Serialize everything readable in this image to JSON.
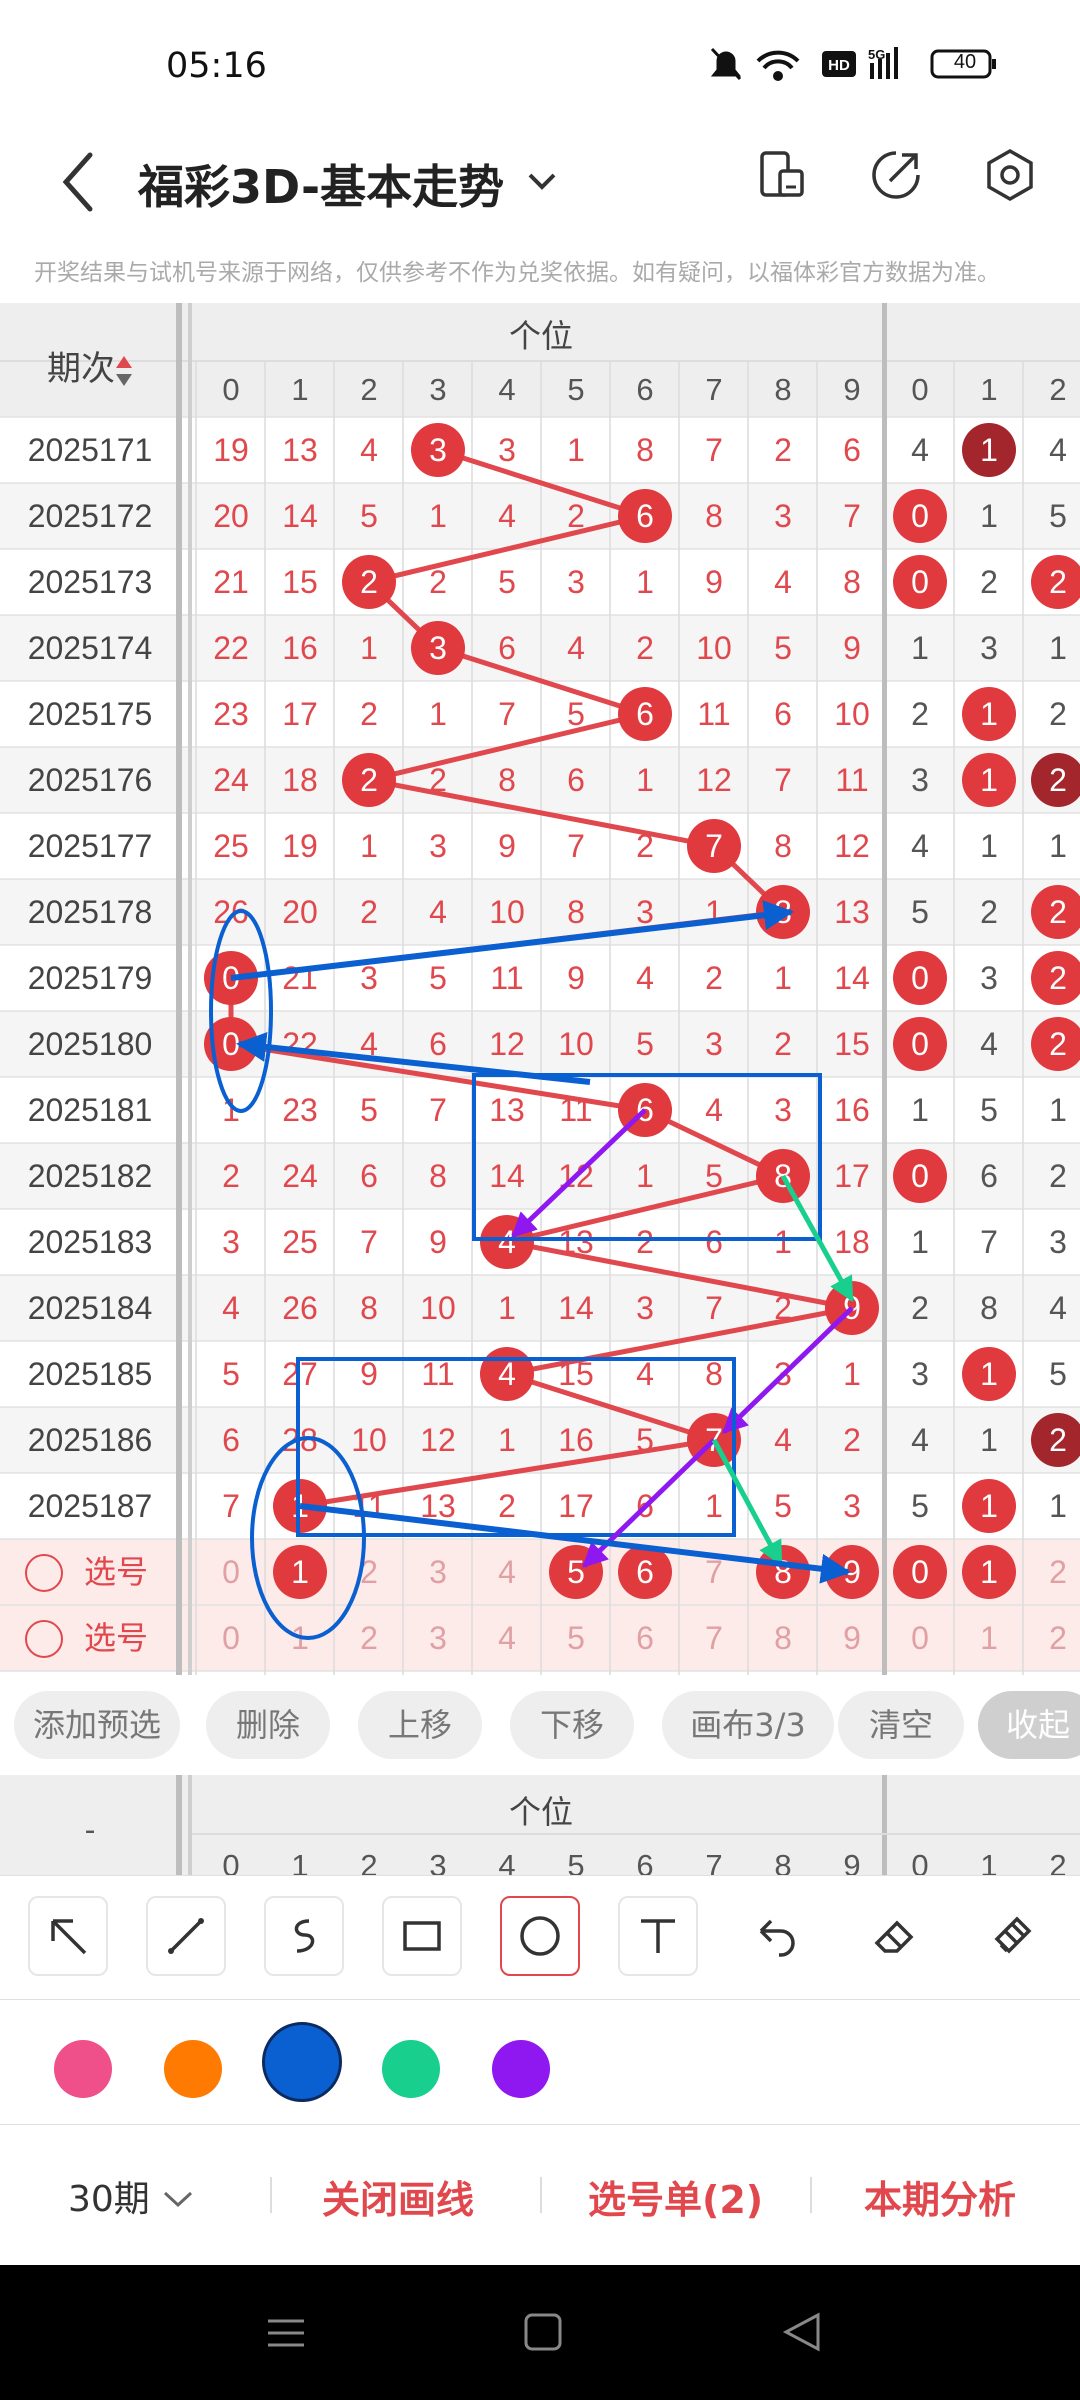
{
  "status": {
    "time": "05:16",
    "battery": "40"
  },
  "header": {
    "title": "福彩3D-基本走势"
  },
  "notice": "开奖结果与试机号来源于网络，仅供参考不作为兑奖依据。如有疑问，以福体彩官方数据为准。",
  "grid": {
    "period_header": "期次",
    "position_header": "个位",
    "digits": [
      "0",
      "1",
      "2",
      "3",
      "4",
      "5",
      "6",
      "7",
      "8",
      "9"
    ],
    "digits_next": [
      "0",
      "1",
      "2"
    ],
    "rows": [
      {
        "period": "2025171",
        "cells": [
          "19",
          "13",
          "4",
          "3",
          "3",
          "1",
          "8",
          "7",
          "2",
          "6"
        ],
        "hit": 3,
        "next": [
          "4",
          "1",
          "4"
        ],
        "next_hit": [
          1
        ],
        "next_dark": [
          1
        ]
      },
      {
        "period": "2025172",
        "cells": [
          "20",
          "14",
          "5",
          "1",
          "4",
          "2",
          "6",
          "8",
          "3",
          "7"
        ],
        "hit": 6,
        "next": [
          "0",
          "1",
          "5"
        ],
        "next_hit": [
          0
        ],
        "next_dark": []
      },
      {
        "period": "2025173",
        "cells": [
          "21",
          "15",
          "2",
          "2",
          "5",
          "3",
          "1",
          "9",
          "4",
          "8"
        ],
        "hit": 2,
        "next": [
          "0",
          "2",
          "2"
        ],
        "next_hit": [
          0,
          2
        ],
        "next_dark": []
      },
      {
        "period": "2025174",
        "cells": [
          "22",
          "16",
          "1",
          "3",
          "6",
          "4",
          "2",
          "10",
          "5",
          "9"
        ],
        "hit": 3,
        "next": [
          "1",
          "3",
          "1"
        ],
        "next_hit": [],
        "next_dark": []
      },
      {
        "period": "2025175",
        "cells": [
          "23",
          "17",
          "2",
          "1",
          "7",
          "5",
          "6",
          "11",
          "6",
          "10"
        ],
        "hit": 6,
        "next": [
          "2",
          "1",
          "2"
        ],
        "next_hit": [
          1
        ],
        "next_dark": []
      },
      {
        "period": "2025176",
        "cells": [
          "24",
          "18",
          "2",
          "2",
          "8",
          "6",
          "1",
          "12",
          "7",
          "11"
        ],
        "hit": 2,
        "next": [
          "3",
          "1",
          "2"
        ],
        "next_hit": [
          1,
          2
        ],
        "next_dark": [
          2
        ]
      },
      {
        "period": "2025177",
        "cells": [
          "25",
          "19",
          "1",
          "3",
          "9",
          "7",
          "2",
          "7",
          "8",
          "12"
        ],
        "hit": 7,
        "next": [
          "4",
          "1",
          "1"
        ],
        "next_hit": [],
        "next_dark": []
      },
      {
        "period": "2025178",
        "cells": [
          "26",
          "20",
          "2",
          "4",
          "10",
          "8",
          "3",
          "1",
          "8",
          "13"
        ],
        "hit": 8,
        "next": [
          "5",
          "2",
          "2"
        ],
        "next_hit": [
          2
        ],
        "next_dark": []
      },
      {
        "period": "2025179",
        "cells": [
          "0",
          "21",
          "3",
          "5",
          "11",
          "9",
          "4",
          "2",
          "1",
          "14"
        ],
        "hit": 0,
        "next": [
          "0",
          "3",
          "2"
        ],
        "next_hit": [
          0,
          2
        ],
        "next_dark": []
      },
      {
        "period": "2025180",
        "cells": [
          "0",
          "22",
          "4",
          "6",
          "12",
          "10",
          "5",
          "3",
          "2",
          "15"
        ],
        "hit": 0,
        "next": [
          "0",
          "4",
          "2"
        ],
        "next_hit": [
          0,
          2
        ],
        "next_dark": []
      },
      {
        "period": "2025181",
        "cells": [
          "1",
          "23",
          "5",
          "7",
          "13",
          "11",
          "6",
          "4",
          "3",
          "16"
        ],
        "hit": 6,
        "next": [
          "1",
          "5",
          "1"
        ],
        "next_hit": [],
        "next_dark": []
      },
      {
        "period": "2025182",
        "cells": [
          "2",
          "24",
          "6",
          "8",
          "14",
          "12",
          "1",
          "5",
          "8",
          "17"
        ],
        "hit": 8,
        "next": [
          "0",
          "6",
          "2"
        ],
        "next_hit": [
          0
        ],
        "next_dark": []
      },
      {
        "period": "2025183",
        "cells": [
          "3",
          "25",
          "7",
          "9",
          "4",
          "13",
          "2",
          "6",
          "1",
          "18"
        ],
        "hit": 4,
        "next": [
          "1",
          "7",
          "3"
        ],
        "next_hit": [],
        "next_dark": []
      },
      {
        "period": "2025184",
        "cells": [
          "4",
          "26",
          "8",
          "10",
          "1",
          "14",
          "3",
          "7",
          "2",
          "9"
        ],
        "hit": 9,
        "next": [
          "2",
          "8",
          "4"
        ],
        "next_hit": [],
        "next_dark": []
      },
      {
        "period": "2025185",
        "cells": [
          "5",
          "27",
          "9",
          "11",
          "4",
          "15",
          "4",
          "8",
          "3",
          "1"
        ],
        "hit": 4,
        "next": [
          "3",
          "1",
          "5"
        ],
        "next_hit": [
          1
        ],
        "next_dark": []
      },
      {
        "period": "2025186",
        "cells": [
          "6",
          "28",
          "10",
          "12",
          "1",
          "16",
          "5",
          "7",
          "4",
          "2"
        ],
        "hit": 7,
        "next": [
          "4",
          "1",
          "2"
        ],
        "next_hit": [
          2
        ],
        "next_dark": [
          2
        ]
      },
      {
        "period": "2025187",
        "cells": [
          "7",
          "1",
          "11",
          "13",
          "2",
          "17",
          "6",
          "1",
          "5",
          "3"
        ],
        "hit": 1,
        "next": [
          "5",
          "1",
          "1"
        ],
        "next_hit": [
          1
        ],
        "next_dark": []
      }
    ],
    "pick_rows": [
      {
        "label": "选号",
        "cells": [
          "0",
          "1",
          "2",
          "3",
          "4",
          "5",
          "6",
          "7",
          "8",
          "9"
        ],
        "hits": [
          1,
          5,
          6,
          8,
          9
        ],
        "next": [
          "0",
          "1",
          "2"
        ],
        "next_hits": [
          0,
          1
        ]
      },
      {
        "label": "选号",
        "cells": [
          "0",
          "1",
          "2",
          "3",
          "4",
          "5",
          "6",
          "7",
          "8",
          "9"
        ],
        "hits": [],
        "next": [
          "0",
          "1",
          "2"
        ],
        "next_hits": []
      }
    ]
  },
  "actions": [
    "添加预选",
    "删除",
    "上移",
    "下移",
    "画布3/3",
    "清空",
    "收起"
  ],
  "mini_header": {
    "dash": "-",
    "position": "个位",
    "digits": [
      "0",
      "1",
      "2",
      "3",
      "4",
      "5",
      "6",
      "7",
      "8",
      "9",
      "0",
      "1",
      "2"
    ]
  },
  "tools": [
    "arrow-tool-icon",
    "line-tool-icon",
    "freehand-tool-icon",
    "rectangle-tool-icon",
    "circle-tool-icon",
    "text-tool-icon",
    "undo-icon",
    "eraser-icon",
    "clear-brush-icon"
  ],
  "colors": {
    "pink": "#f0508a",
    "orange": "#ff7a00",
    "blue": "#0a5fd1",
    "green": "#18cf8e",
    "purple": "#8f17ef",
    "accent": "#e0484d"
  },
  "bottom": {
    "period": "30期",
    "close_lines": "关闭画线",
    "pick_list": "选号单(2)",
    "analysis": "本期分析"
  }
}
